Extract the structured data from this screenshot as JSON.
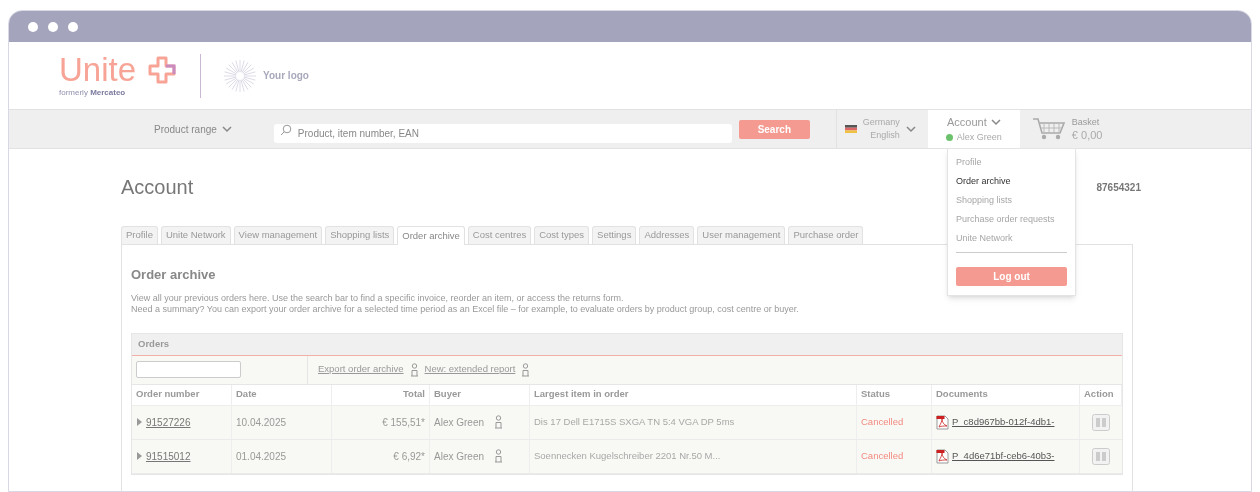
{
  "header": {
    "brand": "Unite",
    "brand_sub_prefix": "formerly",
    "brand_sub_name": "Mercateo",
    "your_logo": "Your logo"
  },
  "nav": {
    "product_range": "Product range",
    "search": {
      "placeholder": "Product, item number, EAN"
    },
    "search_button": "Search",
    "country": "Germany",
    "language": "English",
    "account": {
      "label": "Account",
      "user": "Alex Green",
      "online": true
    },
    "basket": {
      "label": "Basket",
      "total": "€ 0,00"
    }
  },
  "page": {
    "title": "Account",
    "customer_number": "87654321"
  },
  "tabs": [
    {
      "label": "Profile",
      "selected": false
    },
    {
      "label": "Unite Network",
      "selected": false
    },
    {
      "label": "View management",
      "selected": false
    },
    {
      "label": "Shopping lists",
      "selected": false
    },
    {
      "label": "Order archive",
      "selected": true
    },
    {
      "label": "Cost centres",
      "selected": false
    },
    {
      "label": "Cost types",
      "selected": false
    },
    {
      "label": "Settings",
      "selected": false
    },
    {
      "label": "Addresses",
      "selected": false
    },
    {
      "label": "User management",
      "selected": false
    },
    {
      "label": "Purchase order",
      "selected": false
    }
  ],
  "account_menu": {
    "items": [
      {
        "label": "Profile",
        "selected": false
      },
      {
        "label": "Order archive",
        "selected": true
      },
      {
        "label": "Shopping lists",
        "selected": false
      },
      {
        "label": "Purchase order requests",
        "selected": false
      },
      {
        "label": "Unite Network",
        "selected": false
      }
    ],
    "logout": "Log out"
  },
  "panel": {
    "title": "Order archive",
    "intro": [
      "View all your previous orders here. Use the search bar to find a specific invoice, reorder an item, or access the returns form.",
      "Need a summary? You can export your order archive for a selected time period as an Excel file – for example, to evaluate orders by product group, cost centre or buyer."
    ]
  },
  "orders": {
    "title": "Orders",
    "links": [
      "Export order archive",
      "New: extended report"
    ],
    "columns": [
      "Order number",
      "Date",
      "Total",
      "Buyer",
      "Largest item in order",
      "Status",
      "Documents",
      "Action"
    ],
    "rows": [
      {
        "order_number": "91527226",
        "date": "10.04.2025",
        "total": "€ 155,51*",
        "buyer": "Alex Green",
        "item": "Dis 17 Dell E1715S SXGA TN 5:4 VGA DP 5ms",
        "status": "Cancelled",
        "document": "P_c8d967bb-012f-4db1-"
      },
      {
        "order_number": "91515012",
        "date": "01.04.2025",
        "total": "€ 6,92*",
        "buyer": "Alex Green",
        "item": "Soennecken Kugelschreiber 2201 Nr.50 M...",
        "status": "Cancelled",
        "document": "P_4d6e71bf-ceb6-40b3-"
      }
    ]
  }
}
